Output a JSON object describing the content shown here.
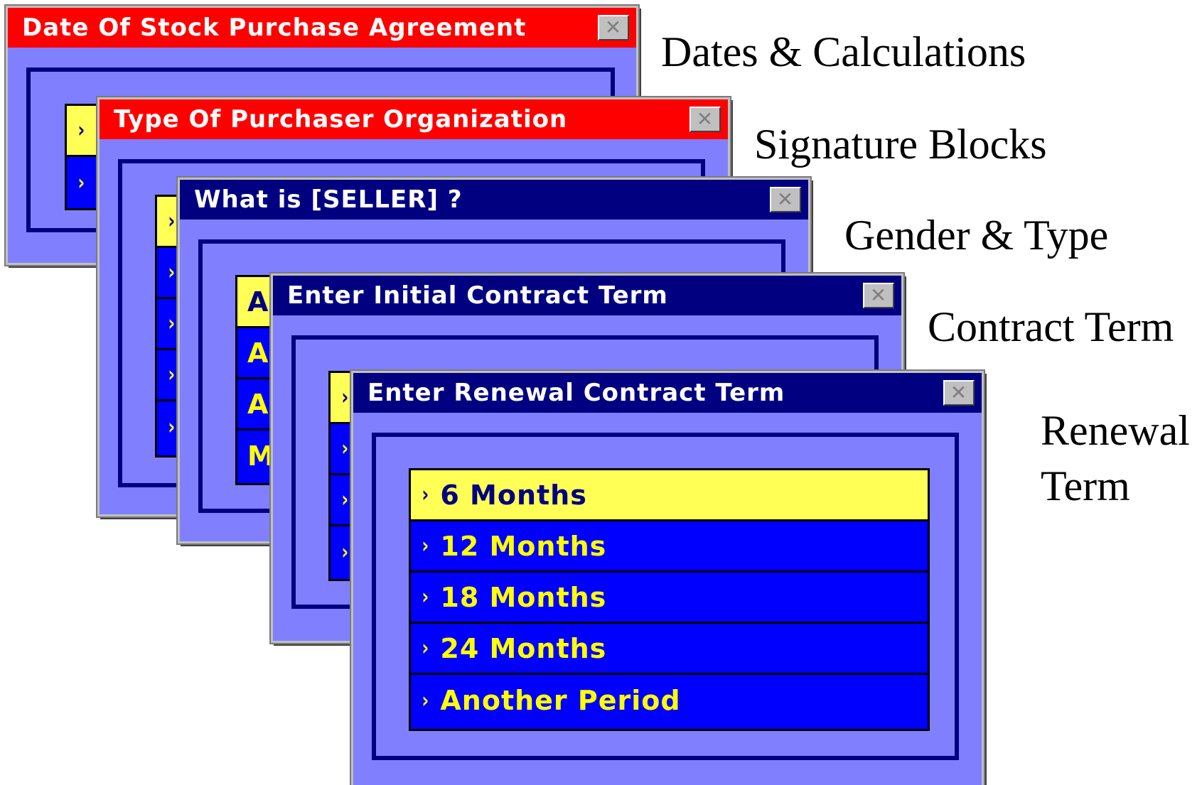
{
  "dialogs": {
    "date": {
      "title": "Date Of Stock Purchase Agreement",
      "close": "✕",
      "options": [
        "",
        ""
      ]
    },
    "purchaser": {
      "title": "Type Of Purchaser Organization",
      "close": "✕",
      "options": [
        "",
        "",
        "",
        "",
        ""
      ]
    },
    "seller": {
      "title": "What is [SELLER] ?",
      "close": "✕",
      "options": [
        "A",
        "A",
        "A",
        "M"
      ]
    },
    "initial": {
      "title": "Enter Initial Contract Term",
      "close": "✕",
      "options": [
        "",
        "",
        "",
        ""
      ]
    },
    "renewal": {
      "title": "Enter Renewal Contract Term",
      "close": "✕",
      "options": [
        "6 Months",
        "12 Months",
        "18 Months",
        "24 Months",
        "Another Period"
      ]
    }
  },
  "chevron": "›",
  "captions": {
    "dates": "Dates & Calculations",
    "signature": "Signature Blocks",
    "gender": "Gender & Type",
    "contract": "Contract Term",
    "renewal_1": "Renewal",
    "renewal_2": "Term"
  },
  "colors": {
    "title_red": "#ff0000",
    "title_navy": "#000080",
    "dialog_body": "#8080ff",
    "option_bg": "#0000ff",
    "option_selected_bg": "#ffff55",
    "option_text": "#ffff00"
  }
}
